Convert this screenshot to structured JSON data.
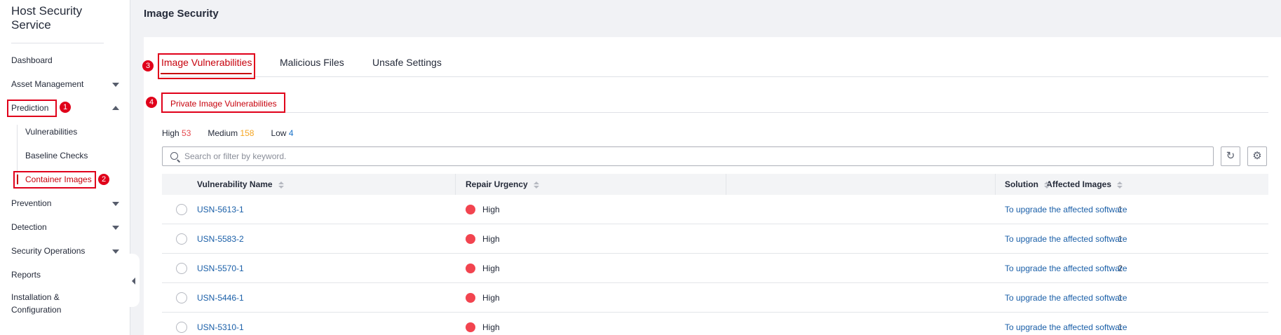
{
  "sidebar": {
    "title": "Host Security Service",
    "items": [
      {
        "label": "Dashboard"
      },
      {
        "label": "Asset Management"
      },
      {
        "label": "Prediction"
      },
      {
        "label": "Vulnerabilities"
      },
      {
        "label": "Baseline Checks"
      },
      {
        "label": "Container Images"
      },
      {
        "label": "Prevention"
      },
      {
        "label": "Detection"
      },
      {
        "label": "Security Operations"
      },
      {
        "label": "Reports"
      },
      {
        "label": "Installation & Configuration"
      }
    ]
  },
  "annotations": [
    "1",
    "2",
    "3",
    "4"
  ],
  "page": {
    "title": "Image Security"
  },
  "tabs": [
    {
      "label": "Image Vulnerabilities",
      "active": true
    },
    {
      "label": "Malicious Files"
    },
    {
      "label": "Unsafe Settings"
    }
  ],
  "subtab": {
    "label": "Private Image Vulnerabilities"
  },
  "stats": {
    "high_label": "High",
    "high_value": "53",
    "medium_label": "Medium",
    "medium_value": "158",
    "low_label": "Low",
    "low_value": "4"
  },
  "search": {
    "placeholder": "Search or filter by keyword.",
    "value": ""
  },
  "toolbar": {
    "refresh_icon": "refresh-icon",
    "settings_icon": "gear-icon"
  },
  "table": {
    "headers": {
      "name": "Vulnerability Name",
      "urgency": "Repair Urgency",
      "affected": "Affected Images",
      "solution": "Solution"
    },
    "rows": [
      {
        "name": "USN-5613-1",
        "urgency": "High",
        "affected": "1",
        "solution": "To upgrade the affected software"
      },
      {
        "name": "USN-5583-2",
        "urgency": "High",
        "affected": "1",
        "solution": "To upgrade the affected software"
      },
      {
        "name": "USN-5570-1",
        "urgency": "High",
        "affected": "2",
        "solution": "To upgrade the affected software"
      },
      {
        "name": "USN-5446-1",
        "urgency": "High",
        "affected": "1",
        "solution": "To upgrade the affected software"
      },
      {
        "name": "USN-5310-1",
        "urgency": "High",
        "affected": "1",
        "solution": "To upgrade the affected software"
      }
    ]
  },
  "colors": {
    "accent": "#c7000b",
    "annotation": "#e0001a",
    "high": "#e5484d",
    "medium": "#f5a623",
    "low": "#1a73c9",
    "link": "#1a5fa8"
  }
}
